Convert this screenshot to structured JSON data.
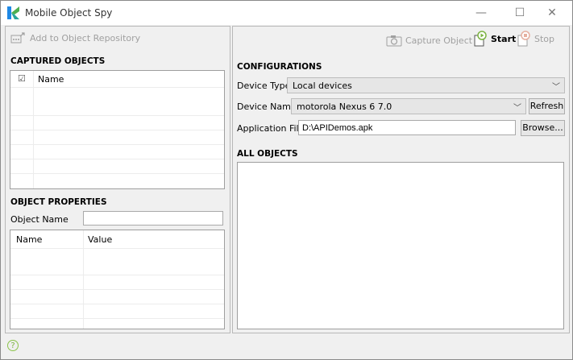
{
  "window": {
    "title": "Mobile Object Spy",
    "controls": {
      "minimize": "—",
      "maximize": "☐",
      "close": "✕"
    }
  },
  "left_toolbar": {
    "add_to_repo": "Add to Object Repository"
  },
  "captured_objects": {
    "title": "CAPTURED OBJECTS",
    "check_glyph": "☑",
    "column_name": "Name"
  },
  "object_properties": {
    "title": "OBJECT PROPERTIES",
    "object_name_label": "Object Name",
    "object_name_value": "",
    "columns": [
      "Name",
      "Value"
    ]
  },
  "right_toolbar": {
    "capture_object": "Capture Object",
    "start": "Start",
    "stop": "Stop"
  },
  "configurations": {
    "title": "CONFIGURATIONS",
    "device_type_label": "Device Type",
    "device_type_value": "Local devices",
    "device_name_label": "Device Name",
    "device_name_value": "motorola Nexus 6 7.0",
    "refresh": "Refresh",
    "app_file_label": "Application File",
    "app_file_value": "D:\\APIDemos.apk",
    "browse": "Browse..."
  },
  "all_objects": {
    "title": "ALL OBJECTS"
  },
  "status": {
    "help_glyph": "?"
  },
  "colors": {
    "accent_green": "#7cb342",
    "logo_green": "#4caf50",
    "logo_blue": "#1e88e5"
  }
}
